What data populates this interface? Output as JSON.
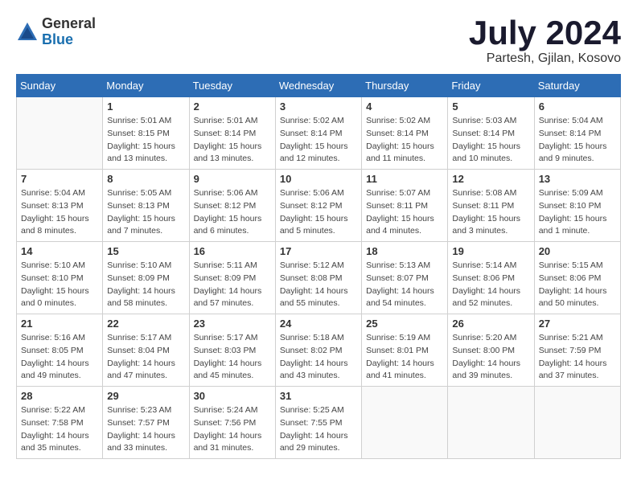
{
  "header": {
    "logo_general": "General",
    "logo_blue": "Blue",
    "month_year": "July 2024",
    "location": "Partesh, Gjilan, Kosovo"
  },
  "days_of_week": [
    "Sunday",
    "Monday",
    "Tuesday",
    "Wednesday",
    "Thursday",
    "Friday",
    "Saturday"
  ],
  "weeks": [
    [
      {
        "day": "",
        "info": ""
      },
      {
        "day": "1",
        "info": "Sunrise: 5:01 AM\nSunset: 8:15 PM\nDaylight: 15 hours\nand 13 minutes."
      },
      {
        "day": "2",
        "info": "Sunrise: 5:01 AM\nSunset: 8:14 PM\nDaylight: 15 hours\nand 13 minutes."
      },
      {
        "day": "3",
        "info": "Sunrise: 5:02 AM\nSunset: 8:14 PM\nDaylight: 15 hours\nand 12 minutes."
      },
      {
        "day": "4",
        "info": "Sunrise: 5:02 AM\nSunset: 8:14 PM\nDaylight: 15 hours\nand 11 minutes."
      },
      {
        "day": "5",
        "info": "Sunrise: 5:03 AM\nSunset: 8:14 PM\nDaylight: 15 hours\nand 10 minutes."
      },
      {
        "day": "6",
        "info": "Sunrise: 5:04 AM\nSunset: 8:14 PM\nDaylight: 15 hours\nand 9 minutes."
      }
    ],
    [
      {
        "day": "7",
        "info": "Sunrise: 5:04 AM\nSunset: 8:13 PM\nDaylight: 15 hours\nand 8 minutes."
      },
      {
        "day": "8",
        "info": "Sunrise: 5:05 AM\nSunset: 8:13 PM\nDaylight: 15 hours\nand 7 minutes."
      },
      {
        "day": "9",
        "info": "Sunrise: 5:06 AM\nSunset: 8:12 PM\nDaylight: 15 hours\nand 6 minutes."
      },
      {
        "day": "10",
        "info": "Sunrise: 5:06 AM\nSunset: 8:12 PM\nDaylight: 15 hours\nand 5 minutes."
      },
      {
        "day": "11",
        "info": "Sunrise: 5:07 AM\nSunset: 8:11 PM\nDaylight: 15 hours\nand 4 minutes."
      },
      {
        "day": "12",
        "info": "Sunrise: 5:08 AM\nSunset: 8:11 PM\nDaylight: 15 hours\nand 3 minutes."
      },
      {
        "day": "13",
        "info": "Sunrise: 5:09 AM\nSunset: 8:10 PM\nDaylight: 15 hours\nand 1 minute."
      }
    ],
    [
      {
        "day": "14",
        "info": "Sunrise: 5:10 AM\nSunset: 8:10 PM\nDaylight: 15 hours\nand 0 minutes."
      },
      {
        "day": "15",
        "info": "Sunrise: 5:10 AM\nSunset: 8:09 PM\nDaylight: 14 hours\nand 58 minutes."
      },
      {
        "day": "16",
        "info": "Sunrise: 5:11 AM\nSunset: 8:09 PM\nDaylight: 14 hours\nand 57 minutes."
      },
      {
        "day": "17",
        "info": "Sunrise: 5:12 AM\nSunset: 8:08 PM\nDaylight: 14 hours\nand 55 minutes."
      },
      {
        "day": "18",
        "info": "Sunrise: 5:13 AM\nSunset: 8:07 PM\nDaylight: 14 hours\nand 54 minutes."
      },
      {
        "day": "19",
        "info": "Sunrise: 5:14 AM\nSunset: 8:06 PM\nDaylight: 14 hours\nand 52 minutes."
      },
      {
        "day": "20",
        "info": "Sunrise: 5:15 AM\nSunset: 8:06 PM\nDaylight: 14 hours\nand 50 minutes."
      }
    ],
    [
      {
        "day": "21",
        "info": "Sunrise: 5:16 AM\nSunset: 8:05 PM\nDaylight: 14 hours\nand 49 minutes."
      },
      {
        "day": "22",
        "info": "Sunrise: 5:17 AM\nSunset: 8:04 PM\nDaylight: 14 hours\nand 47 minutes."
      },
      {
        "day": "23",
        "info": "Sunrise: 5:17 AM\nSunset: 8:03 PM\nDaylight: 14 hours\nand 45 minutes."
      },
      {
        "day": "24",
        "info": "Sunrise: 5:18 AM\nSunset: 8:02 PM\nDaylight: 14 hours\nand 43 minutes."
      },
      {
        "day": "25",
        "info": "Sunrise: 5:19 AM\nSunset: 8:01 PM\nDaylight: 14 hours\nand 41 minutes."
      },
      {
        "day": "26",
        "info": "Sunrise: 5:20 AM\nSunset: 8:00 PM\nDaylight: 14 hours\nand 39 minutes."
      },
      {
        "day": "27",
        "info": "Sunrise: 5:21 AM\nSunset: 7:59 PM\nDaylight: 14 hours\nand 37 minutes."
      }
    ],
    [
      {
        "day": "28",
        "info": "Sunrise: 5:22 AM\nSunset: 7:58 PM\nDaylight: 14 hours\nand 35 minutes."
      },
      {
        "day": "29",
        "info": "Sunrise: 5:23 AM\nSunset: 7:57 PM\nDaylight: 14 hours\nand 33 minutes."
      },
      {
        "day": "30",
        "info": "Sunrise: 5:24 AM\nSunset: 7:56 PM\nDaylight: 14 hours\nand 31 minutes."
      },
      {
        "day": "31",
        "info": "Sunrise: 5:25 AM\nSunset: 7:55 PM\nDaylight: 14 hours\nand 29 minutes."
      },
      {
        "day": "",
        "info": ""
      },
      {
        "day": "",
        "info": ""
      },
      {
        "day": "",
        "info": ""
      }
    ]
  ]
}
